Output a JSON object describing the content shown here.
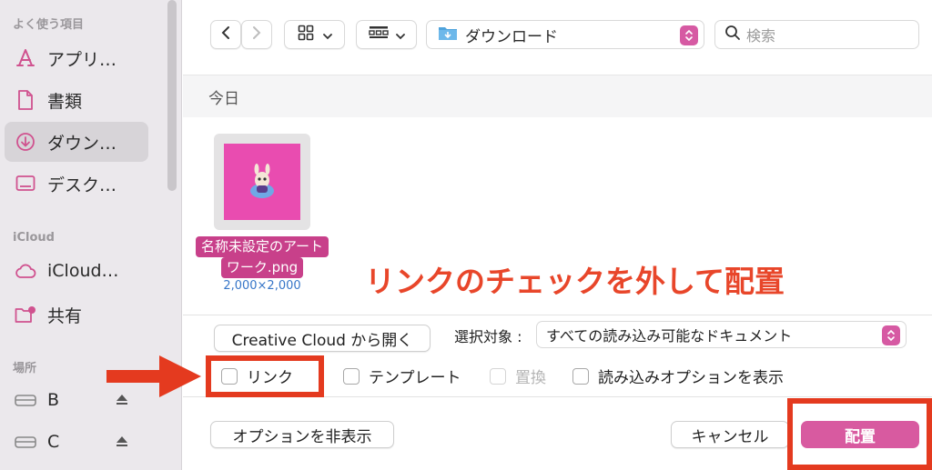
{
  "sidebar": {
    "favorites_title": "よく使う項目",
    "favorites": [
      {
        "label": "アプリ…",
        "icon": "applications-icon"
      },
      {
        "label": "書類",
        "icon": "document-icon"
      },
      {
        "label": "ダウン…",
        "icon": "downloads-icon"
      },
      {
        "label": "デスク…",
        "icon": "desktop-icon"
      }
    ],
    "icloud_title": "iCloud",
    "icloud": [
      {
        "label": "iCloud…",
        "icon": "cloud-icon"
      },
      {
        "label": "共有",
        "icon": "shared-folder-icon"
      }
    ],
    "locations_title": "場所",
    "locations": [
      {
        "label": "B",
        "icon": "drive-icon"
      },
      {
        "label": "C",
        "icon": "drive-icon"
      }
    ]
  },
  "toolbar": {
    "location": "ダウンロード",
    "search_placeholder": "検索"
  },
  "files": {
    "group_header": "今日",
    "item": {
      "name_line1": "名称未設定のアート",
      "name_line2": "ワーク.png",
      "dimensions": "2,000×2,000"
    }
  },
  "annotation_text": "リンクのチェックを外して配置",
  "options": {
    "open_cc_button": "Creative Cloud から開く",
    "select_label": "選択対象 :",
    "select_value": "すべての読み込み可能なドキュメント",
    "checkboxes": [
      {
        "label": "リンク",
        "checked": false,
        "enabled": true
      },
      {
        "label": "テンプレート",
        "checked": false,
        "enabled": true
      },
      {
        "label": "置換",
        "checked": false,
        "enabled": false
      },
      {
        "label": "読み込みオプションを表示",
        "checked": false,
        "enabled": true
      }
    ]
  },
  "bottom": {
    "hide_options_button": "オプションを非表示",
    "cancel_button": "キャンセル",
    "place_button": "配置"
  },
  "colors": {
    "accent": "#d85aa0",
    "annotation_red": "#e43a1f",
    "thumb_bg": "#e94cb0"
  }
}
